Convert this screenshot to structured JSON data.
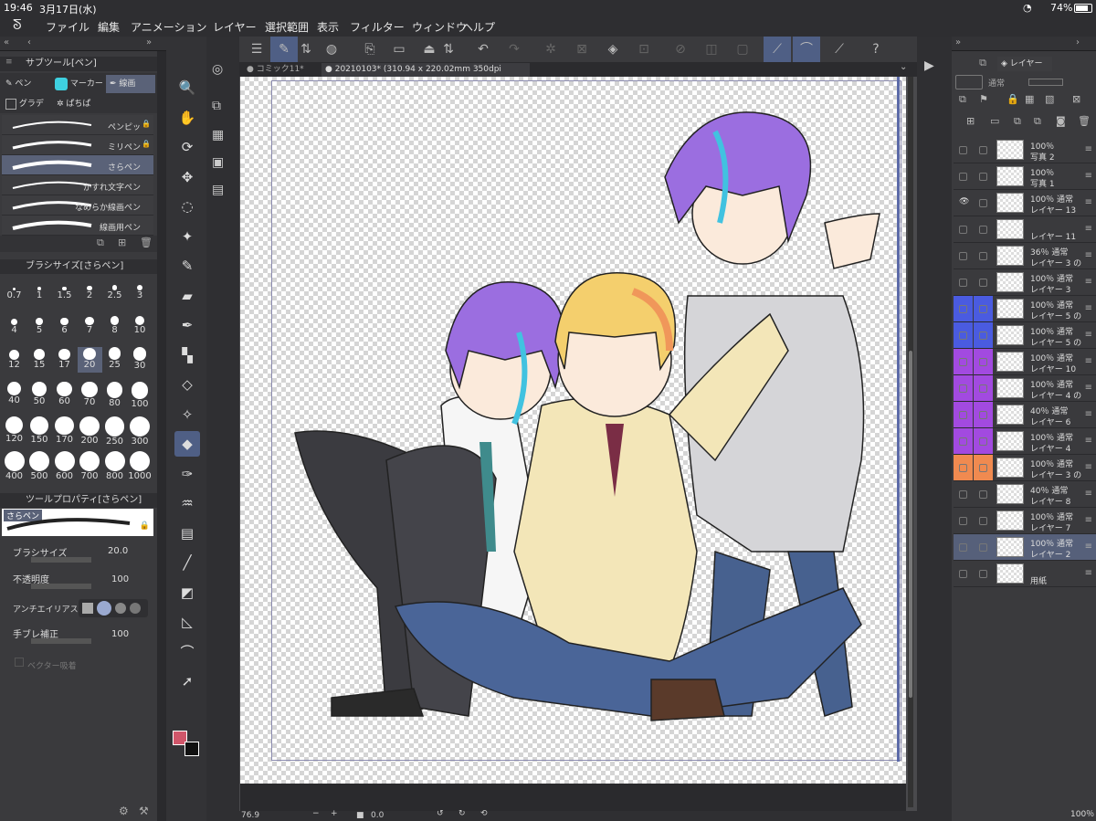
{
  "status": {
    "time": "19:46",
    "date": "3月17日(水)",
    "battery": "74%"
  },
  "menu": [
    "ファイル",
    "編集",
    "アニメーション",
    "レイヤー",
    "選択範囲",
    "表示",
    "フィルター",
    "ウィンドウ",
    "ヘルプ"
  ],
  "subtool": {
    "title": "サブツール[ペン]",
    "tabs": [
      "ペン",
      "マーカー",
      "線画",
      "グラデ",
      "ぱちぱ"
    ],
    "items": [
      {
        "label": "ペンピッ",
        "locked": true
      },
      {
        "label": "ミリペン",
        "locked": true
      },
      {
        "label": "さらペン",
        "locked": false,
        "selected": true
      },
      {
        "label": "かすれ文字ペン",
        "locked": false
      },
      {
        "label": "なめらか線画ペン",
        "locked": false
      },
      {
        "label": "線画用ペン",
        "locked": false
      }
    ]
  },
  "brushsize": {
    "title": "ブラシサイズ[さらペン]",
    "rows": [
      [
        "0.7",
        "1",
        "1.5",
        "2",
        "2.5",
        "3"
      ],
      [
        "4",
        "5",
        "6",
        "7",
        "8",
        "10"
      ],
      [
        "12",
        "15",
        "17",
        "20",
        "25",
        "30"
      ],
      [
        "40",
        "50",
        "60",
        "70",
        "80",
        "100"
      ],
      [
        "120",
        "150",
        "170",
        "200",
        "250",
        "300"
      ],
      [
        "400",
        "500",
        "600",
        "700",
        "800",
        "1000"
      ]
    ],
    "selected": "20"
  },
  "toolprop": {
    "title": "ツールプロパティ[さらペン]",
    "name": "さらペン",
    "brush_size_label": "ブラシサイズ",
    "brush_size": "20.0",
    "opacity_label": "不透明度",
    "opacity": "100",
    "antialias_label": "アンチエイリアス",
    "stabilizer_label": "手ブレ補正",
    "stabilizer": "100",
    "vector_label": "ベクター吸着"
  },
  "tabs": [
    {
      "label": "コミック11*"
    },
    {
      "label": "20210103* (310.94 x 220.02mm 350dpi 76.9%)"
    }
  ],
  "zoom": {
    "value": "76.9",
    "angle": "0.0"
  },
  "layerpanel": {
    "title": "レイヤー",
    "blend": "通常",
    "layers": [
      {
        "pct": "100％",
        "mode": "",
        "name": "写真 2",
        "color": null,
        "eye": false,
        "sel": false
      },
      {
        "pct": "100％",
        "mode": "",
        "name": "写真 1",
        "color": null,
        "eye": false,
        "sel": false
      },
      {
        "pct": "100％",
        "mode": "通常",
        "name": "レイヤー 13",
        "color": null,
        "eye": true,
        "sel": false
      },
      {
        "pct": "",
        "mode": "",
        "name": "レイヤー 11",
        "color": null,
        "eye": false,
        "sel": false
      },
      {
        "pct": "36％",
        "mode": "通常",
        "name": "レイヤー 3 の",
        "color": null,
        "eye": false,
        "sel": false
      },
      {
        "pct": "100％",
        "mode": "通常",
        "name": "レイヤー 3",
        "color": null,
        "eye": false,
        "sel": false
      },
      {
        "pct": "100％",
        "mode": "通常",
        "name": "レイヤー 5 の",
        "color": "#4a5be0",
        "eye": false,
        "sel": false
      },
      {
        "pct": "100％",
        "mode": "通常",
        "name": "レイヤー 5 の",
        "color": "#4a5be0",
        "eye": false,
        "sel": false
      },
      {
        "pct": "100％",
        "mode": "通常",
        "name": "レイヤー 10",
        "color": "#a24ae0",
        "eye": false,
        "sel": false
      },
      {
        "pct": "100％",
        "mode": "通常",
        "name": "レイヤー 4 の",
        "color": "#a24ae0",
        "eye": false,
        "sel": false
      },
      {
        "pct": "40％",
        "mode": "通常",
        "name": "レイヤー 6",
        "color": "#a24ae0",
        "eye": false,
        "sel": false
      },
      {
        "pct": "100％",
        "mode": "通常",
        "name": "レイヤー 4",
        "color": "#a24ae0",
        "eye": false,
        "sel": false
      },
      {
        "pct": "100％",
        "mode": "通常",
        "name": "レイヤー 3 の",
        "color": "#f08a50",
        "eye": false,
        "sel": false
      },
      {
        "pct": "40％",
        "mode": "通常",
        "name": "レイヤー 8",
        "color": null,
        "eye": false,
        "sel": false
      },
      {
        "pct": "100％",
        "mode": "通常",
        "name": "レイヤー 7",
        "color": null,
        "eye": false,
        "sel": false
      },
      {
        "pct": "100％",
        "mode": "通常",
        "name": "レイヤー 2",
        "color": null,
        "eye": false,
        "sel": true
      },
      {
        "pct": "",
        "mode": "",
        "name": "用紙",
        "color": null,
        "eye": false,
        "sel": false
      }
    ],
    "bottom_pct": "100％"
  },
  "colors": {
    "main": "#d0566a",
    "sub": "#111111",
    "accent": "#4f5f85"
  },
  "icons": [
    "search-icon",
    "hand-icon",
    "rotate-icon",
    "move-icon",
    "lasso-icon",
    "magic-wand-icon",
    "eyedropper-icon",
    "pen-icon",
    "fill-icon",
    "eraser-icon",
    "sparkle-icon",
    "paint-bucket-icon",
    "ink-pen-icon",
    "blend-icon",
    "frame-icon",
    "line-icon",
    "gradient-icon",
    "polygon-icon",
    "curve-icon",
    "select-arrow-icon",
    "text-icon"
  ]
}
